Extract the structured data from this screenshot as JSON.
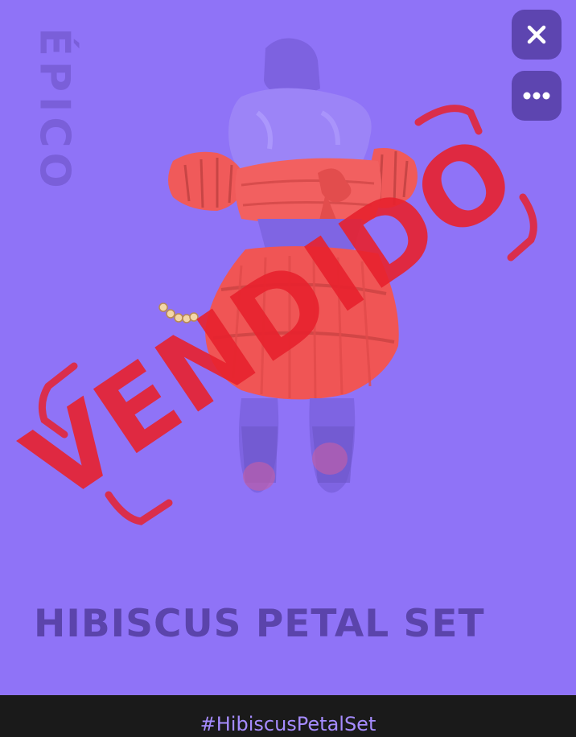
{
  "card": {
    "rarity": "ÉPICO",
    "item_name": "HIBISCUS PETAL SET",
    "stamp_text": "VENDIDO",
    "background_color": "#8f73f7"
  },
  "controls": {
    "close_icon": "close-icon",
    "more_icon": "more-options-icon"
  },
  "footer": {
    "hashtag": "#HibiscusPetalSet"
  }
}
